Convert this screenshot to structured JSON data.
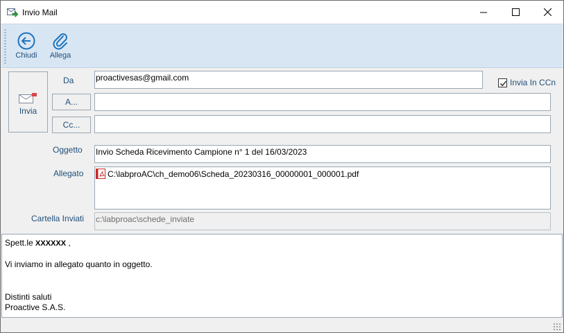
{
  "window": {
    "title": "Invio Mail"
  },
  "toolbar": {
    "close_label": "Chiudi",
    "attach_label": "Allega"
  },
  "form": {
    "send_label": "Invia",
    "from_label": "Da",
    "from_value": "proactivesas@gmail.com",
    "to_button": "A...",
    "to_value": "",
    "cc_button": "Cc...",
    "cc_value": "",
    "bcc_checkbox_label": "Invia In CCn",
    "bcc_checked": true,
    "subject_label": "Oggetto",
    "subject_value": "Invio Scheda Ricevimento Campione n° 1 del 16/03/2023",
    "attachment_label": "Allegato",
    "attachment_value": "C:\\labproAC\\ch_demo06\\Scheda_20230316_00000001_000001.pdf",
    "sent_folder_label": "Cartella Inviati",
    "sent_folder_value": "c:\\labproac\\schede_inviate"
  },
  "body": {
    "greeting_prefix": "Spett.le ",
    "recipient_name": "XXXXXX",
    "greeting_suffix": " ,",
    "line_2": "Vi inviamo in allegato quanto in oggetto.",
    "line_3": "Distinti saluti",
    "line_4": "Proactive S.A.S."
  },
  "colors": {
    "toolbar_bg": "#d8e6f3",
    "label_blue": "#1f4e79",
    "icon_blue": "#1e73be"
  }
}
